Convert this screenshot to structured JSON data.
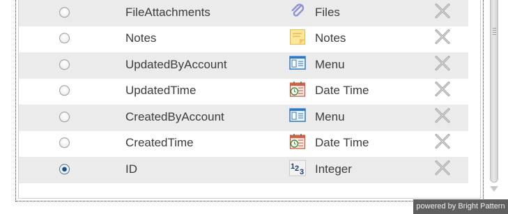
{
  "rows": [
    {
      "field": "FileAttachments",
      "type": "Files",
      "icon": "paperclip-icon",
      "selected": false
    },
    {
      "field": "Notes",
      "type": "Notes",
      "icon": "sticky-note-icon",
      "selected": false
    },
    {
      "field": "UpdatedByAccount",
      "type": "Menu",
      "icon": "menu-list-icon",
      "selected": false
    },
    {
      "field": "UpdatedTime",
      "type": "Date Time",
      "icon": "calendar-clock-icon",
      "selected": false
    },
    {
      "field": "CreatedByAccount",
      "type": "Menu",
      "icon": "menu-list-icon",
      "selected": false
    },
    {
      "field": "CreatedTime",
      "type": "Date Time",
      "icon": "calendar-clock-icon",
      "selected": false
    },
    {
      "field": "ID",
      "type": "Integer",
      "icon": "integer-123-icon",
      "selected": true
    }
  ],
  "footer": {
    "powered_by": "powered by Bright Pattern"
  },
  "colors": {
    "row_alt": "#ebebeb",
    "text": "#3c3c3c",
    "badge_bg": "#5f5f5f",
    "radio_selected": "#1d4f84"
  }
}
